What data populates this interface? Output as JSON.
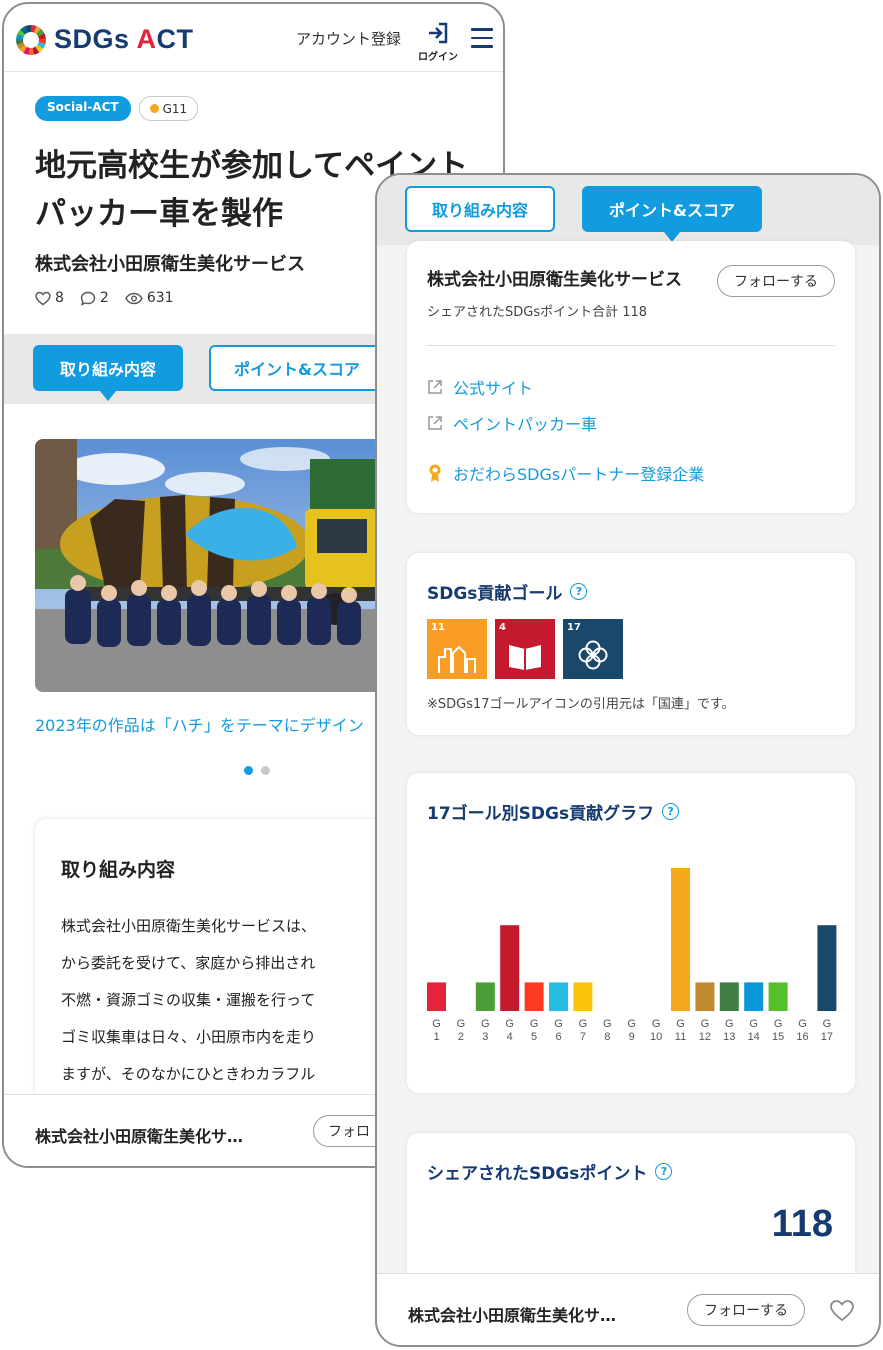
{
  "header": {
    "logo_text_pre": "SDGs ",
    "logo_text_a": "A",
    "logo_text_post": "CT",
    "account_link": "アカウント登録",
    "login_label": "ログイン"
  },
  "article": {
    "tags": {
      "category": "Social-ACT",
      "goal": "G11"
    },
    "title": "地元高校生が参加してペイントパッカー車を製作",
    "company": "株式会社小田原衛生美化サービス",
    "stats": {
      "likes": "8",
      "comments": "2",
      "views": "631"
    }
  },
  "tabs": {
    "content": "取り組み内容",
    "points": "ポイント&スコア"
  },
  "gallery": {
    "caption": "2023年の作品は「ハチ」をテーマにデザイン",
    "slides": 2,
    "current": 1
  },
  "content_section": {
    "title": "取り組み内容",
    "lines": [
      "株式会社小田原衛生美化サービスは、",
      "から委託を受けて、家庭から排出され",
      "不燃・資源ゴミの収集・運搬を行って",
      "ゴミ収集車は日々、小田原市内を走り",
      "ますが、そのなかにひときわカラフル"
    ]
  },
  "bottom_bar": {
    "company": "株式会社小田原衛生美化サ…",
    "follow": "フォローする",
    "follow_short": "フォロ"
  },
  "company_card": {
    "company": "株式会社小田原衛生美化サービス",
    "follow": "フォローする",
    "shared_total": "シェアされたSDGsポイント合計 118",
    "links": [
      {
        "label": "公式サイト",
        "icon": "external-link-icon"
      },
      {
        "label": "ペイントパッカー車",
        "icon": "external-link-icon"
      },
      {
        "label": "おだわらSDGsパートナー登録企業",
        "icon": "award-icon"
      }
    ]
  },
  "goals_card": {
    "title": "SDGs貢献ゴール",
    "icons": [
      {
        "num": "11",
        "color": "#f99d26"
      },
      {
        "num": "4",
        "color": "#c5192d"
      },
      {
        "num": "17",
        "color": "#19486a"
      }
    ],
    "note": "※SDGs17ゴールアイコンの引用元は「国連」です。"
  },
  "chart_card": {
    "title": "17ゴール別SDGs貢献グラフ"
  },
  "chart_data": {
    "type": "bar",
    "categories": [
      "G1",
      "G2",
      "G3",
      "G4",
      "G5",
      "G6",
      "G7",
      "G8",
      "G9",
      "G10",
      "G11",
      "G12",
      "G13",
      "G14",
      "G15",
      "G16",
      "G17"
    ],
    "values": [
      1,
      0,
      1,
      3,
      1,
      1,
      1,
      0,
      0,
      0,
      5,
      1,
      1,
      1,
      1,
      0,
      3
    ],
    "colors": [
      "#e5243b",
      "#dda63a",
      "#4c9f38",
      "#c5192d",
      "#ff3a21",
      "#26bde2",
      "#fcc30b",
      "#a21942",
      "#fd6925",
      "#dd1367",
      "#f4a81c",
      "#bf8b2e",
      "#3f7e44",
      "#0a97d9",
      "#56c02b",
      "#00689d",
      "#19486a"
    ],
    "grid": false,
    "ylim": [
      0,
      5
    ]
  },
  "points_card": {
    "title": "シェアされたSDGsポイント",
    "value": "118"
  }
}
